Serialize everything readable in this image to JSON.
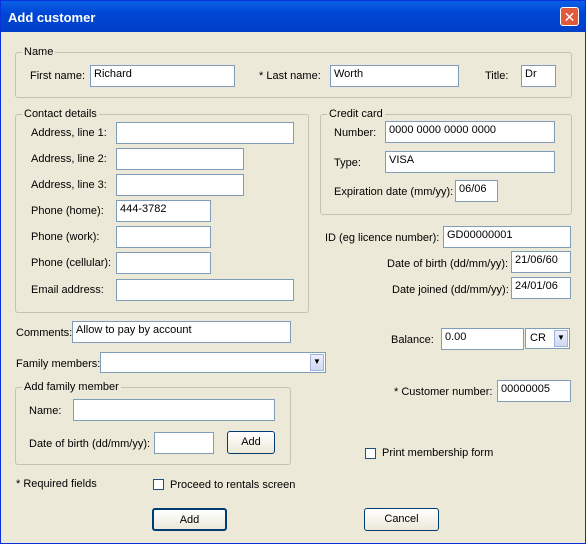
{
  "window": {
    "title": "Add customer",
    "close_glyph": "✕"
  },
  "name_group": {
    "legend": "Name",
    "first_name_label": "First name:",
    "first_name": "Richard",
    "last_name_label": "* Last name:",
    "last_name": "Worth",
    "title_label": "Title:",
    "title": "Dr"
  },
  "contact": {
    "legend": "Contact details",
    "address1_label": "Address, line 1:",
    "address1": "",
    "address2_label": "Address, line 2:",
    "address2": "",
    "address3_label": "Address, line 3:",
    "address3": "",
    "phone_home_label": "Phone (home):",
    "phone_home": "444-3782",
    "phone_work_label": "Phone (work):",
    "phone_work": "",
    "phone_cell_label": "Phone (cellular):",
    "phone_cell": "",
    "email_label": "Email address:",
    "email": ""
  },
  "credit_card": {
    "legend": "Credit card",
    "number_label": "Number:",
    "number": "0000 0000 0000 0000",
    "type_label": "Type:",
    "type": "VISA",
    "expiry_label": "Expiration date (mm/yy):",
    "expiry": "06/06"
  },
  "details": {
    "id_label": "ID (eg licence number):",
    "id": "GD00000001",
    "dob_label": "Date of birth (dd/mm/yy):",
    "dob": "21/06/60",
    "joined_label": "Date joined (dd/mm/yy):",
    "joined": "24/01/06",
    "balance_label": "Balance:",
    "balance": "0.00",
    "balance_type": "CR",
    "customer_number_label": "* Customer number:",
    "customer_number": "00000005",
    "print_form_label": "Print membership form"
  },
  "comments": {
    "label": "Comments:",
    "value": "Allow to pay by account"
  },
  "family": {
    "label": "Family members:",
    "selected": "",
    "add_legend": "Add family member",
    "name_label": "Name:",
    "name": "",
    "dob_label": "Date of birth (dd/mm/yy):",
    "dob": "",
    "add_button": "Add"
  },
  "footer": {
    "required_note": "* Required fields",
    "proceed_label": "Proceed to rentals screen",
    "add_button": "Add",
    "cancel_button": "Cancel"
  },
  "icons": {
    "dropdown": "chevron-down-icon",
    "close": "close-icon"
  }
}
